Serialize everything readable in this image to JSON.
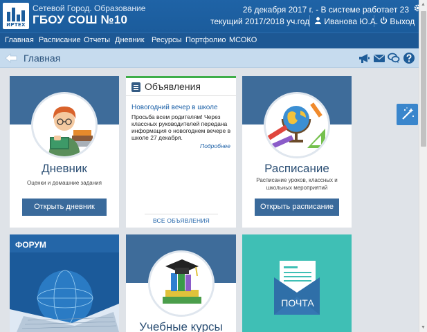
{
  "header": {
    "logo_text": "ИРТЕХ",
    "app_name": "Сетевой Город. Образование",
    "school_name": "ГБОУ СОШ №10",
    "status": "26 декабря 2017 г. - В системе работает 23",
    "school_year": "текущий 2017/2018 уч.год",
    "user_name": "Иванова Ю.А.",
    "logout_label": "Выход"
  },
  "nav": {
    "items": [
      "Главная",
      "Расписание",
      "Отчеты",
      "Дневник",
      "Ресурсы",
      "Портфолио",
      "МСОКО"
    ]
  },
  "page": {
    "title": "Главная"
  },
  "cards": {
    "diary": {
      "title": "Дневник",
      "subtitle": "Оценки и домашние задания",
      "button": "Открыть дневник"
    },
    "announcements": {
      "title": "Объявления",
      "news_title": "Новогодний вечер в школе",
      "news_text": "Просьба всем родителям! Через классных руководителей передана информация о новогоднем вечере в школе 27 декабря.",
      "more_link": "Подробнее",
      "all_link": "ВСЕ ОБЪЯВЛЕНИЯ"
    },
    "schedule": {
      "title": "Расписание",
      "subtitle": "Расписание уроков, классных и школьных мероприятий",
      "button": "Открыть расписание"
    },
    "forum": {
      "title": "ФОРУМ"
    },
    "courses": {
      "title": "Учебные курсы"
    },
    "mail": {
      "title": "ПОЧТА"
    }
  },
  "icons": [
    "logo-icon",
    "gear-icon",
    "user-icon",
    "power-icon",
    "back-arrow-icon",
    "megaphone-icon",
    "envelope-icon",
    "chat-icon",
    "help-icon",
    "magic-wand-icon"
  ],
  "colors": {
    "header": "#1b5c9c",
    "nav": "#1d5894",
    "titlebar": "#c6dbee",
    "card_top": "#3e6c9a",
    "button": "#3a6a9b",
    "announcement_accent": "#3fae49",
    "mail_card": "#3fbfb5"
  }
}
